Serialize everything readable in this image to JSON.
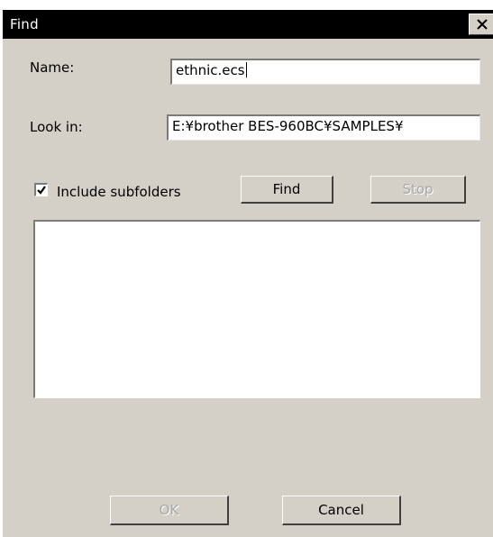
{
  "window": {
    "title": "Find"
  },
  "form": {
    "name_label": "Name:",
    "name_value": "ethnic.ecs",
    "lookin_label": "Look in:",
    "lookin_value": "E:¥brother BES-960BC¥SAMPLES¥",
    "include_subfolders_label": "Include subfolders",
    "include_subfolders_checked": true
  },
  "buttons": {
    "find": "Find",
    "stop": "Stop",
    "ok": "OK",
    "cancel": "Cancel"
  },
  "results": {
    "items": []
  },
  "colors": {
    "dialog_face": "#d4d0c8",
    "titlebar": "#000000",
    "disabled_text": "#a8a8a8"
  }
}
